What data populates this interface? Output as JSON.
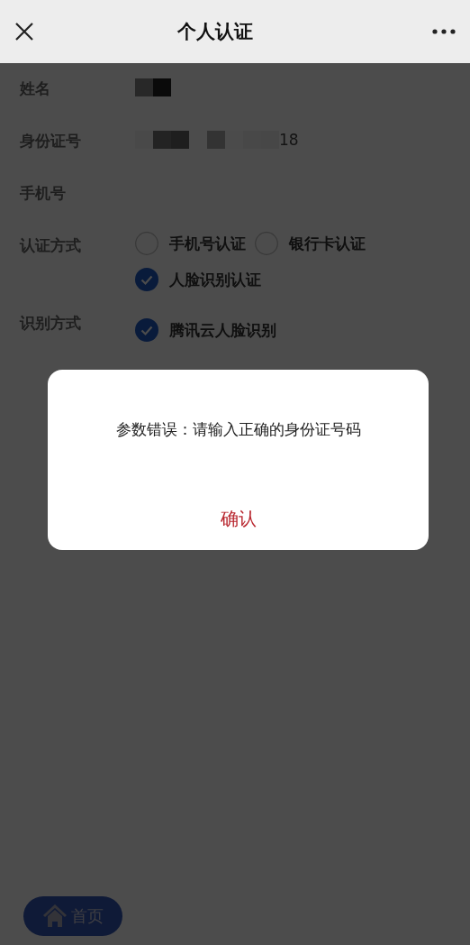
{
  "nav_bar": {
    "title": "个人认证"
  },
  "form": [
    {
      "kind": "masked",
      "label": "姓名"
    },
    {
      "kind": "masked_text",
      "label": "身份证号",
      "value": "18"
    },
    {
      "kind": "empty",
      "label": "手机号"
    },
    {
      "kind": "radio",
      "label": "认证方式",
      "options": [
        {
          "label": "手机号认证",
          "selected": false
        },
        {
          "label": "银行卡认证",
          "selected": false
        },
        {
          "label": "人脸识别认证",
          "selected": true
        }
      ]
    },
    {
      "kind": "radio",
      "label": "识别方式",
      "options": [
        {
          "label": "腾讯云人脸识别",
          "selected": true
        }
      ]
    }
  ],
  "dialog": {
    "message": "参数错误：请输入正确的身份证号码",
    "button": "确认"
  },
  "home_button": {
    "label": "首页"
  }
}
